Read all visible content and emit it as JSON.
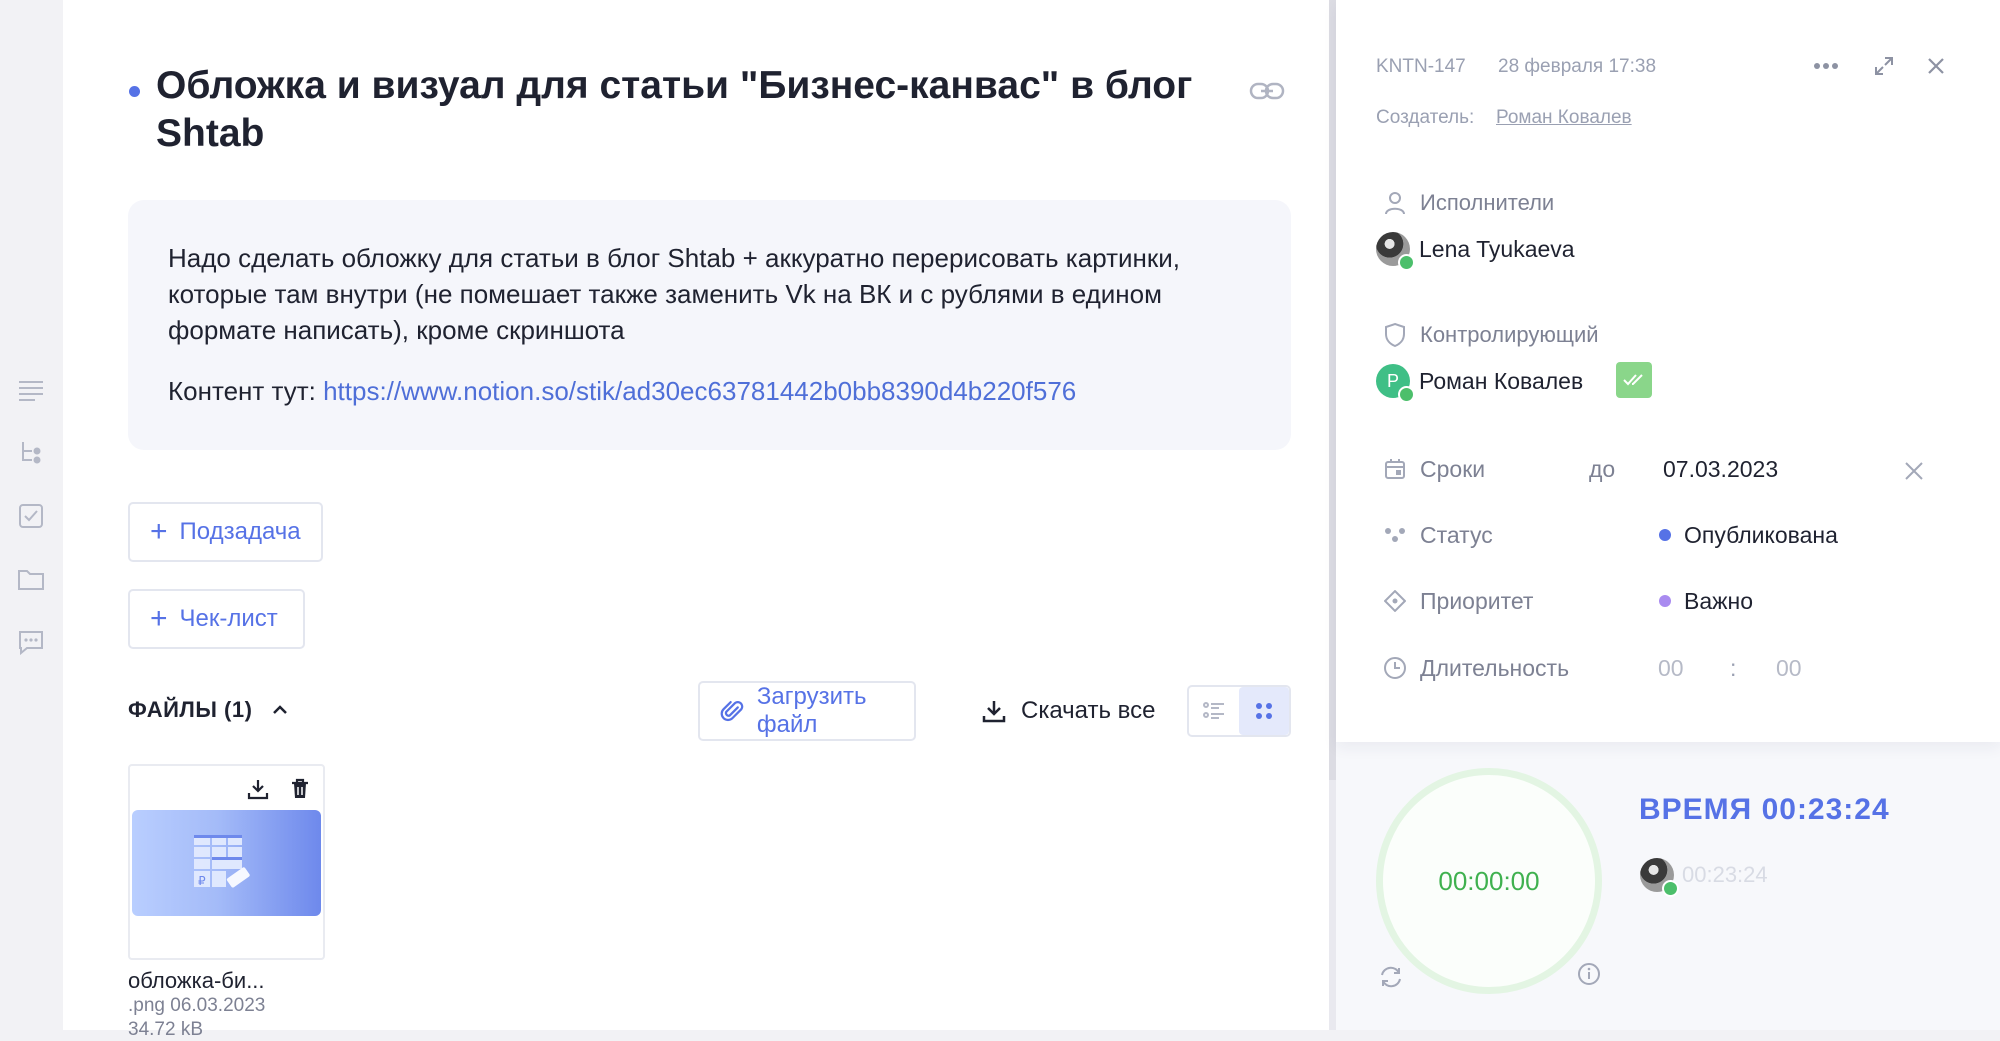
{
  "task": {
    "title": "Обложка и визуал для статьи \"Бизнес-канвас\" в блог Shtab",
    "description": "Надо сделать обложку для статьи в блог Shtab + аккуратно перерисовать картинки, которые там внутри (не помешает также заменить Vk на ВК и с рублями в едином формате написать), кроме скриншота",
    "content_label": "Контент тут: ",
    "content_link": "https://www.notion.so/stik/ad30ec63781442b0bb8390d4b220f576"
  },
  "actions": {
    "subtask_label": "Подзадача",
    "checklist_label": "Чек-лист"
  },
  "files": {
    "header": "ФАЙЛЫ (1)",
    "upload_label": "Загрузить файл",
    "download_all_label": "Скачать все",
    "items": [
      {
        "name": "обложка-би...",
        "meta": ".png 06.03.2023",
        "size": "34.72 kB"
      }
    ]
  },
  "panel": {
    "task_id": "KNTN-147",
    "created_at": "28 февраля 17:38",
    "creator_label": "Создатель:",
    "creator_name": "Роман Ковалев",
    "assignees_label": "Исполнители",
    "assignee_name": "Lena Tyukaeva",
    "controller_label": "Контролирующий",
    "controller_name": "Роман Ковалев",
    "controller_initial": "Р",
    "deadline_label": "Сроки",
    "deadline_prefix": "до",
    "deadline_value": "07.03.2023",
    "status_label": "Статус",
    "status_value": "Опубликована",
    "priority_label": "Приоритет",
    "priority_value": "Важно",
    "duration_label": "Длительность",
    "duration_hours": "00",
    "duration_sep": ":",
    "duration_minutes": "00"
  },
  "timer": {
    "display": "00:00:00",
    "total_label": "ВРЕМЯ 00:23:24",
    "user_time": "00:23:24"
  },
  "colors": {
    "accent": "#5672e6",
    "status_dot": "#5672e6",
    "priority_dot": "#a98bf0",
    "timer_green": "#3fb14f",
    "ok_green": "#4cbf6b"
  }
}
